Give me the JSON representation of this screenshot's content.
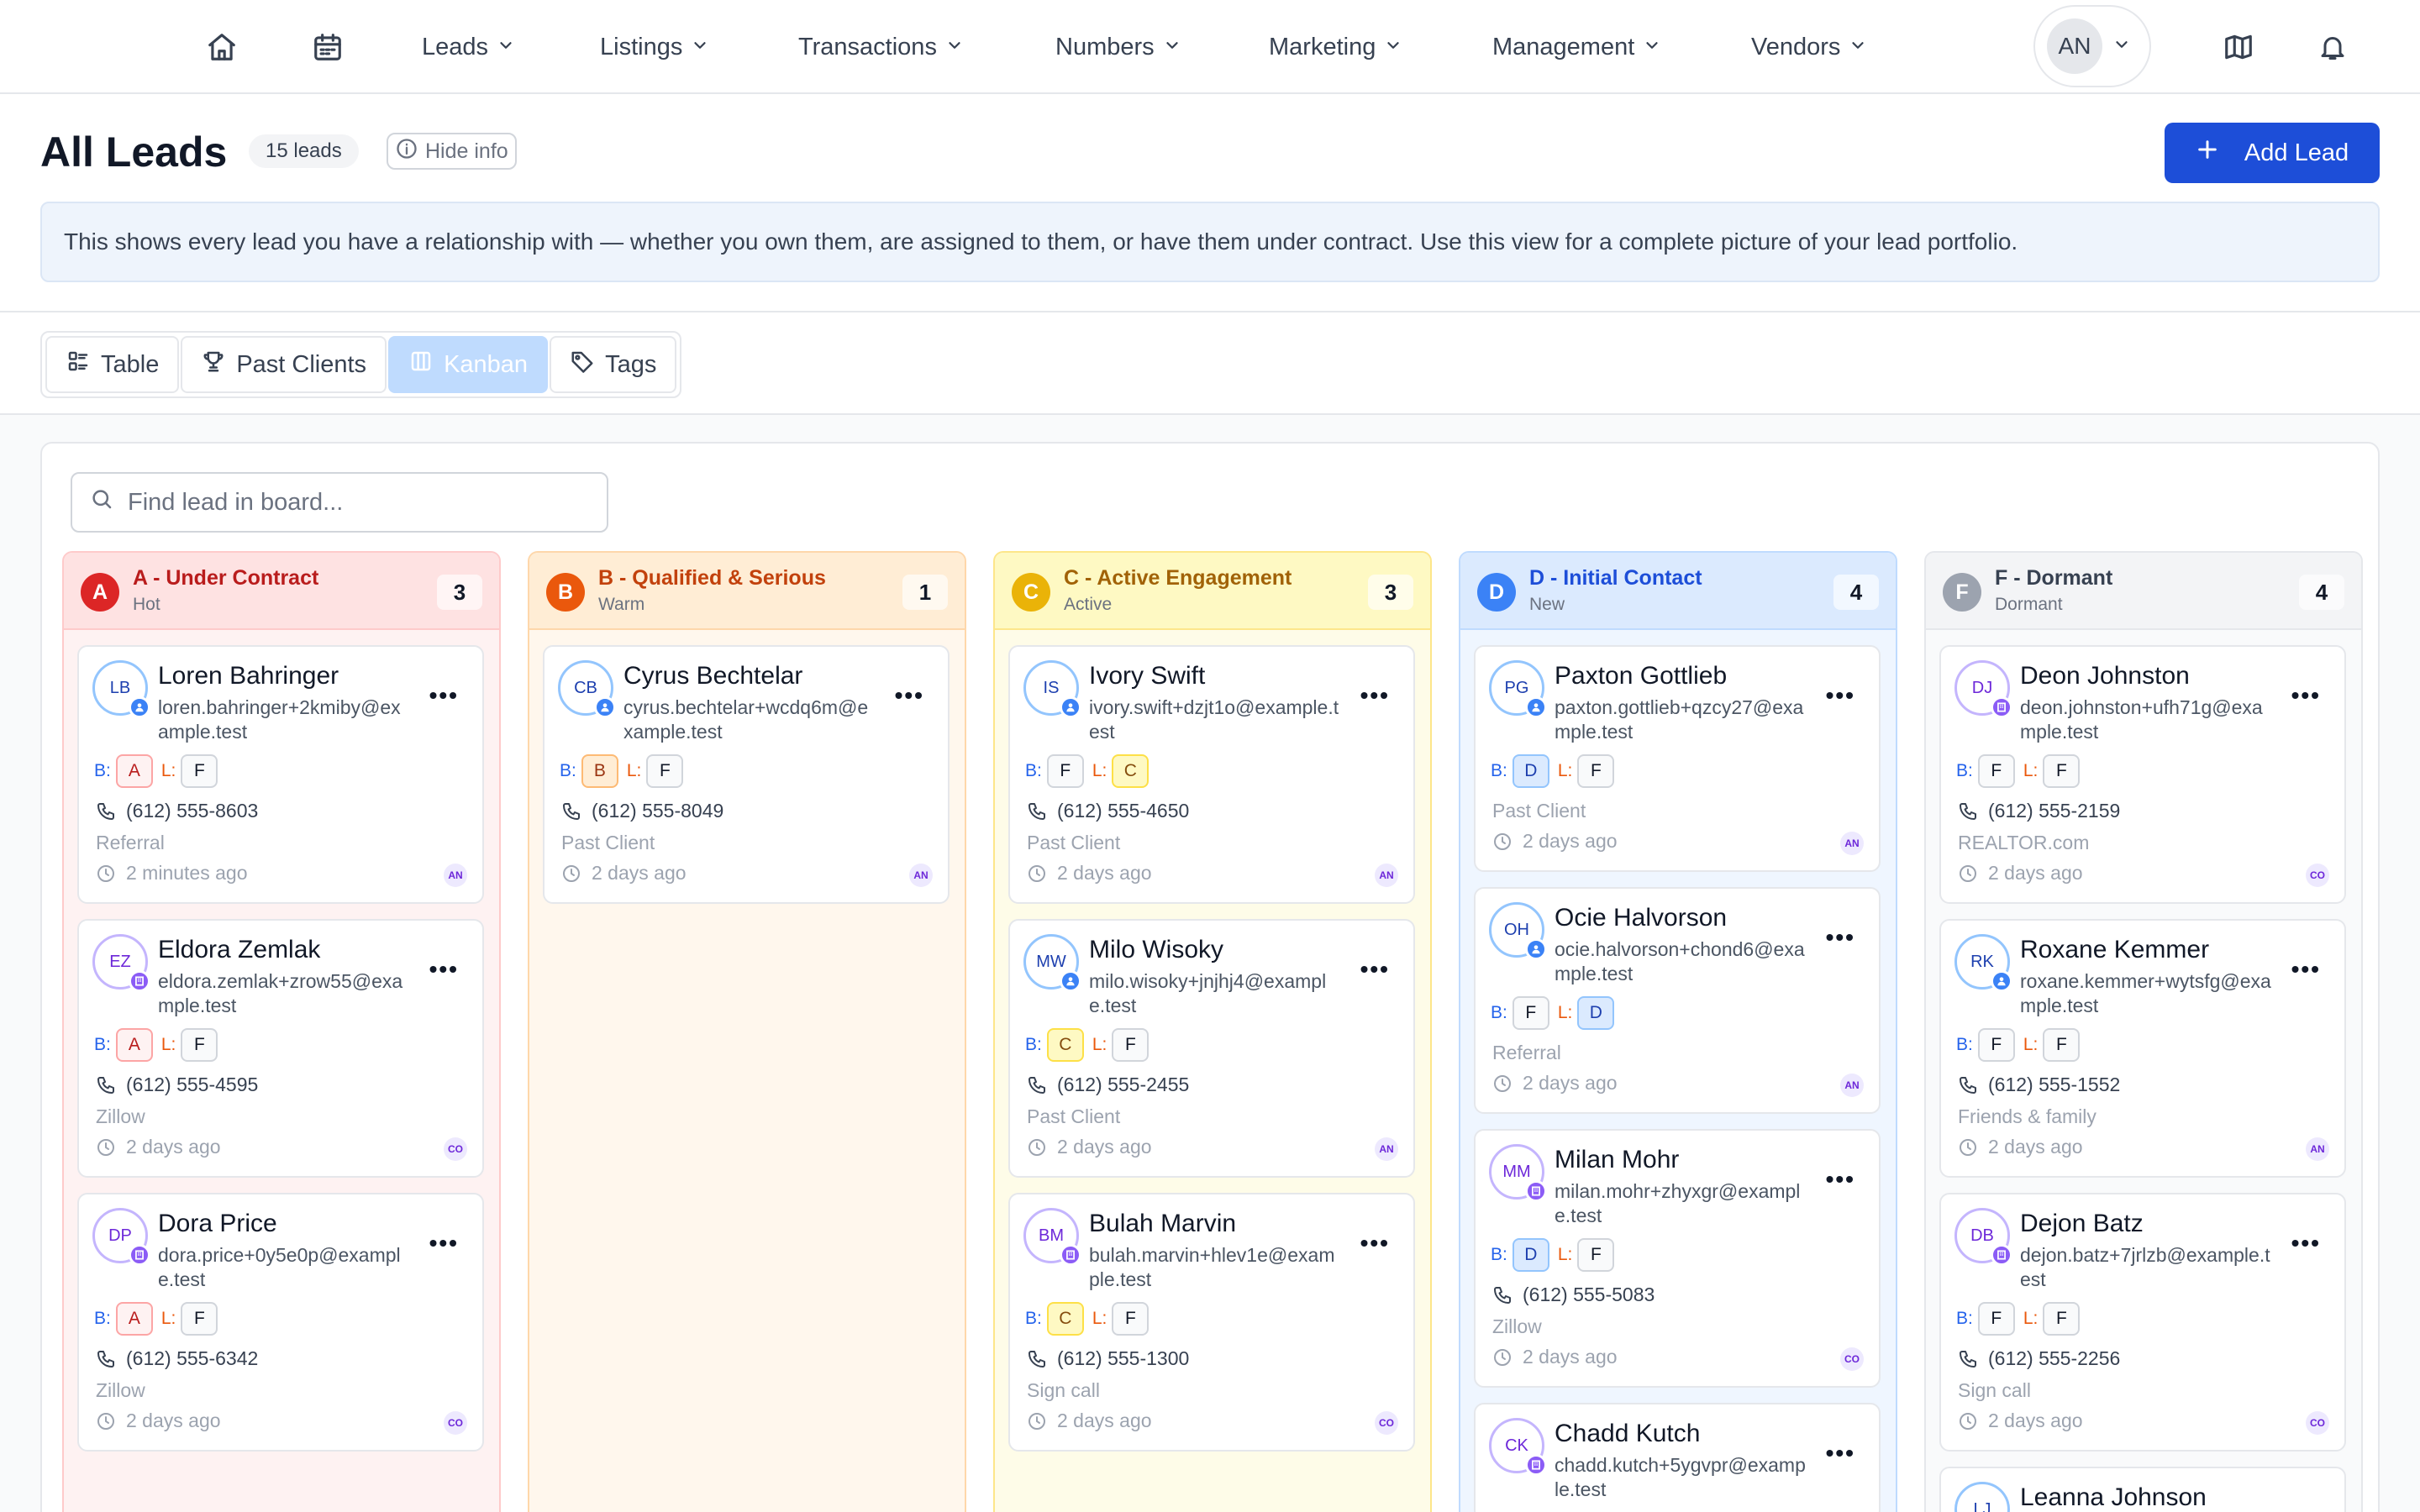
{
  "nav": {
    "home_icon": "home-icon",
    "calendar_icon": "calendar-icon",
    "menus": [
      "Leads",
      "Listings",
      "Transactions",
      "Numbers",
      "Marketing",
      "Management",
      "Vendors"
    ],
    "user_initials": "AN",
    "map_icon": "map-icon",
    "bell_icon": "bell-icon"
  },
  "header": {
    "title": "All Leads",
    "count_badge": "15 leads",
    "hide_info": "Hide info",
    "add_lead": "Add Lead",
    "info_text": "This shows every lead you have a relationship with — whether you own them, are assigned to them, or have them under contract. Use this view for a complete picture of your lead portfolio."
  },
  "views": {
    "tabs": [
      "Table",
      "Past Clients",
      "Kanban",
      "Tags"
    ],
    "active": "Kanban"
  },
  "board": {
    "search_placeholder": "Find lead in board...",
    "grade_labels": {
      "b": "B:",
      "l": "L:"
    },
    "columns": [
      {
        "letter": "A",
        "title": "A - Under Contract",
        "subtitle": "Hot",
        "count": "3",
        "cards": [
          {
            "initials": "LB",
            "name": "Loren Bahringer",
            "email": "loren.bahringer+2kmiby@example.test",
            "b": "A",
            "l": "F",
            "phone": "(612) 555-8603",
            "source": "Referral",
            "time": "2 minutes ago",
            "owner": "AN"
          },
          {
            "initials": "EZ",
            "name": "Eldora Zemlak",
            "email": "eldora.zemlak+zrow55@example.test",
            "b": "A",
            "l": "F",
            "phone": "(612) 555-4595",
            "source": "Zillow",
            "time": "2 days ago",
            "owner": "CO"
          },
          {
            "initials": "DP",
            "name": "Dora Price",
            "email": "dora.price+0y5e0p@example.test",
            "b": "A",
            "l": "F",
            "phone": "(612) 555-6342",
            "source": "Zillow",
            "time": "2 days ago",
            "owner": "CO"
          }
        ]
      },
      {
        "letter": "B",
        "title": "B - Qualified & Serious",
        "subtitle": "Warm",
        "count": "1",
        "cards": [
          {
            "initials": "CB",
            "name": "Cyrus Bechtelar",
            "email": "cyrus.bechtelar+wcdq6m@example.test",
            "b": "B",
            "l": "F",
            "phone": "(612) 555-8049",
            "source": "Past Client",
            "time": "2 days ago",
            "owner": "AN"
          }
        ]
      },
      {
        "letter": "C",
        "title": "C - Active Engagement",
        "subtitle": "Active",
        "count": "3",
        "cards": [
          {
            "initials": "IS",
            "name": "Ivory Swift",
            "email": "ivory.swift+dzjt1o@example.test",
            "b": "F",
            "l": "C",
            "phone": "(612) 555-4650",
            "source": "Past Client",
            "time": "2 days ago",
            "owner": "AN"
          },
          {
            "initials": "MW",
            "name": "Milo Wisoky",
            "email": "milo.wisoky+jnjhj4@example.test",
            "b": "C",
            "l": "F",
            "phone": "(612) 555-2455",
            "source": "Past Client",
            "time": "2 days ago",
            "owner": "AN"
          },
          {
            "initials": "BM",
            "name": "Bulah Marvin",
            "email": "bulah.marvin+hlev1e@example.test",
            "b": "C",
            "l": "F",
            "phone": "(612) 555-1300",
            "source": "Sign call",
            "time": "2 days ago",
            "owner": "CO"
          }
        ]
      },
      {
        "letter": "D",
        "title": "D - Initial Contact",
        "subtitle": "New",
        "count": "4",
        "cards": [
          {
            "initials": "PG",
            "name": "Paxton Gottlieb",
            "email": "paxton.gottlieb+qzcy27@example.test",
            "b": "D",
            "l": "F",
            "phone": "",
            "source": "Past Client",
            "time": "2 days ago",
            "owner": "AN"
          },
          {
            "initials": "OH",
            "name": "Ocie Halvorson",
            "email": "ocie.halvorson+chond6@example.test",
            "b": "F",
            "l": "D",
            "phone": "",
            "source": "Referral",
            "time": "2 days ago",
            "owner": "AN"
          },
          {
            "initials": "MM",
            "name": "Milan Mohr",
            "email": "milan.mohr+zhyxgr@example.test",
            "b": "D",
            "l": "F",
            "phone": "(612) 555-5083",
            "source": "Zillow",
            "time": "2 days ago",
            "owner": "CO"
          },
          {
            "initials": "CK",
            "name": "Chadd Kutch",
            "email": "chadd.kutch+5ygvpr@example.test",
            "b": "",
            "l": "",
            "phone": "",
            "source": "",
            "time": "",
            "owner": ""
          }
        ]
      },
      {
        "letter": "F",
        "title": "F - Dormant",
        "subtitle": "Dormant",
        "count": "4",
        "cards": [
          {
            "initials": "DJ",
            "name": "Deon Johnston",
            "email": "deon.johnston+ufh71g@example.test",
            "b": "F",
            "l": "F",
            "phone": "(612) 555-2159",
            "source": "REALTOR.com",
            "time": "2 days ago",
            "owner": "CO"
          },
          {
            "initials": "RK",
            "name": "Roxane Kemmer",
            "email": "roxane.kemmer+wytsfg@example.test",
            "b": "F",
            "l": "F",
            "phone": "(612) 555-1552",
            "source": "Friends & family",
            "time": "2 days ago",
            "owner": "AN"
          },
          {
            "initials": "DB",
            "name": "Dejon Batz",
            "email": "dejon.batz+7jrlzb@example.test",
            "b": "F",
            "l": "F",
            "phone": "(612) 555-2256",
            "source": "Sign call",
            "time": "2 days ago",
            "owner": "CO"
          },
          {
            "initials": "LJ",
            "name": "Leanna Johnson",
            "email": "",
            "b": "",
            "l": "",
            "phone": "",
            "source": "",
            "time": "",
            "owner": ""
          }
        ]
      }
    ]
  },
  "colors": {
    "primary": "#1d4ed8",
    "grade_a": "#dc2626",
    "grade_b": "#ea580c",
    "grade_c": "#d97706",
    "grade_d": "#2563eb",
    "grade_f": "#6b7280"
  }
}
